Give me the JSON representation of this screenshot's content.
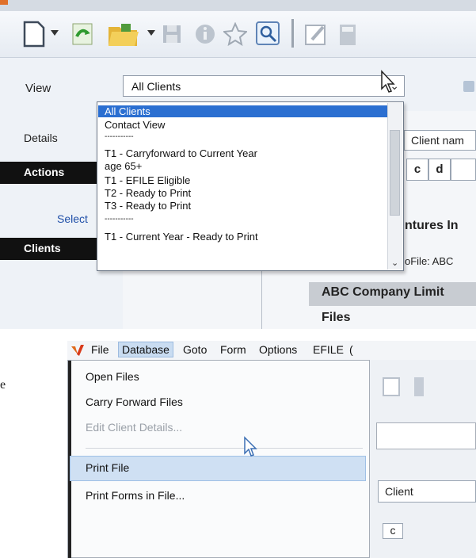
{
  "top_panel": {
    "view_label": "View",
    "view_combo_value": "All Clients",
    "details_label": "Details",
    "actions_label": "Actions",
    "select_link": "Select",
    "clients_label": "Clients",
    "client_name_header": "Client nam",
    "column_letters": [
      "c",
      "d"
    ],
    "company_partial": "ntures In",
    "efile_partial": "oFile: ABC",
    "company_row": "ABC Company Limit",
    "files_label": "Files",
    "dropdown_items": [
      "All Clients",
      "Contact View",
      "-----------",
      "T1 - Carryforward to Current Year",
      "age 65+",
      "T1 - EFILE Eligible",
      "T2 - Ready to Print",
      "T3 - Ready to Print",
      "-----------",
      "T1 - Current Year - Ready to Print"
    ]
  },
  "bottom_panel": {
    "left_edge_text": "e",
    "menubar": [
      "File",
      "Database",
      "Goto",
      "Form",
      "Options",
      "EFILE",
      "("
    ],
    "active_menu": "Database",
    "menu_items": [
      {
        "label": "Open Files",
        "enabled": true
      },
      {
        "label": "Carry Forward Files",
        "enabled": true
      },
      {
        "label": "Edit Client Details...",
        "enabled": false
      },
      {
        "label": "Print File",
        "enabled": true,
        "highlighted": true
      },
      {
        "label": "Print Forms in File...",
        "enabled": true
      }
    ],
    "client_header": "Client",
    "column_letter": "c"
  },
  "colors": {
    "selection_blue": "#2b6fd1",
    "menu_highlight": "#cfe0f3",
    "active_menu_bg": "#c9dcf1",
    "black_bar": "#111111"
  },
  "icons": [
    "new-document-icon",
    "dropdown-arrow-icon",
    "green-refresh-icon",
    "folder-icon",
    "save-icon",
    "info-icon",
    "star-icon",
    "search-icon",
    "edit-icon",
    "calculator-icon",
    "mouse-cursor-icon"
  ]
}
